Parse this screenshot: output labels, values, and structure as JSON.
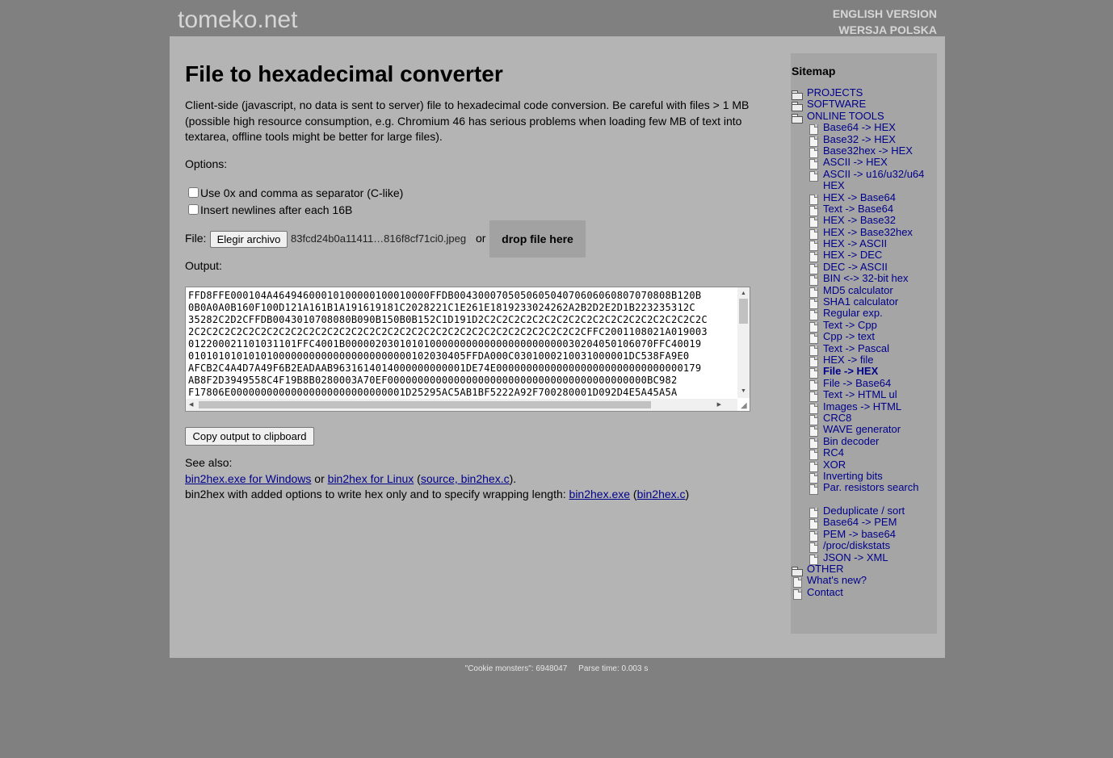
{
  "header": {
    "logo": "tomeko.net",
    "lang_english": "ENGLISH VERSION",
    "lang_polish": "WERSJA POLSKA"
  },
  "main": {
    "title": "File to hexadecimal converter",
    "description": "Client-side (javascript, no data is sent to server) file to hexadecimal code conversion. Be careful with files > 1 MB (possible high resource consumption, e.g. Chromium 46 has serious problems when loading few MB of text into textarea, offline tools might be better for large files).",
    "options_label": "Options:",
    "option_c_like": "Use 0x and comma as separator (C-like)",
    "option_newlines": "Insert newlines after each 16B",
    "option_c_like_checked": false,
    "option_newlines_checked": false,
    "file_label": "File:",
    "file_button": "Elegir archivo",
    "file_name": "83fcd24b0a11411…816f8cf71ci0.jpeg",
    "or_label": "or",
    "drop_label": "drop file here",
    "output_label": "Output:",
    "output_text": "FFD8FFE000104A46494600010100000100010000FFDB004300070505060504070606060807070808B120B\n0B0A0A0B160F100D121A161B1A191619181C2028221C1E261E1819233024262A2B2D2E2D1B223235312C\n35282C2D2CFFDB0043010708080B090B150B0B152C1D191D2C2C2C2C2C2C2C2C2C2C2C2C2C2C2C2C2C2C2C\n2C2C2C2C2C2C2C2C2C2C2C2C2C2C2C2C2C2C2C2C2C2C2C2C2C2C2C2C2C2C2C2C2CFFC2001108021A019003\n012200021101031101FFC4001B000002030101010000000000000000000000030204050106070FFC40019\n0101010101010100000000000000000000000102030405FFDA000C0301000210031000001DC538FA9E0\nAFCB2C4A4D7A49F6B2EADAAB9631614014000000000001DE74E0000000000000000000000000000000179\nAB8F2D3949558C4F19B8B0280003A70EF0000000000000000000000000000000000000000000BC982\nF17806E00000000000000000000000000001D25295AC5AB1BF5222A92F700280001D092D4E5A45A5A",
    "copy_button": "Copy output to clipboard",
    "see_also": "See also:",
    "link_windows": "bin2hex.exe for Windows",
    "or_text": " or ",
    "link_linux": "bin2hex for Linux",
    "paren_open": " (",
    "link_source": "source, bin2hex.c",
    "paren_close": ").",
    "bin2hex_text": "bin2hex with added options to write hex only and to specify wrapping length: ",
    "link_exe": "bin2hex.exe",
    "paren_open2": " (",
    "link_c": "bin2hex.c",
    "paren_close2": ")"
  },
  "sitemap": {
    "title": "Sitemap",
    "items": [
      {
        "label": "PROJECTS",
        "icon": "folder-icon"
      },
      {
        "label": "SOFTWARE",
        "icon": "folder-icon"
      },
      {
        "label": "ONLINE TOOLS",
        "icon": "folder-open-icon"
      },
      {
        "label": "Base64 -> HEX",
        "icon": "document-icon"
      },
      {
        "label": "Base32 -> HEX",
        "icon": "document-icon"
      },
      {
        "label": "Base32hex -> HEX",
        "icon": "document-icon"
      },
      {
        "label": "ASCII -> HEX",
        "icon": "document-icon"
      },
      {
        "label": "ASCII -> u16/u32/u64 HEX",
        "icon": "document-icon"
      },
      {
        "label": "HEX -> Base64",
        "icon": "document-icon"
      },
      {
        "label": "Text -> Base64",
        "icon": "document-icon"
      },
      {
        "label": "HEX -> Base32",
        "icon": "document-icon"
      },
      {
        "label": "HEX -> Base32hex",
        "icon": "document-icon"
      },
      {
        "label": "HEX -> ASCII",
        "icon": "document-icon"
      },
      {
        "label": "HEX -> DEC",
        "icon": "document-icon"
      },
      {
        "label": "DEC -> ASCII",
        "icon": "document-icon"
      },
      {
        "label": "BIN <-> 32-bit hex",
        "icon": "document-icon"
      },
      {
        "label": "MD5 calculator",
        "icon": "document-icon"
      },
      {
        "label": "SHA1 calculator",
        "icon": "document-icon"
      },
      {
        "label": "Regular exp.",
        "icon": "document-icon"
      },
      {
        "label": "Text -> Cpp",
        "icon": "document-icon"
      },
      {
        "label": "Cpp -> text",
        "icon": "document-icon"
      },
      {
        "label": "Text -> Pascal",
        "icon": "document-icon"
      },
      {
        "label": "HEX -> file",
        "icon": "document-icon"
      },
      {
        "label": "File -> HEX",
        "icon": "document-icon",
        "active": true
      },
      {
        "label": "File -> Base64",
        "icon": "document-icon"
      },
      {
        "label": "Text -> HTML ul",
        "icon": "document-icon"
      },
      {
        "label": "Images -> HTML",
        "icon": "document-icon"
      },
      {
        "label": "CRC8",
        "icon": "document-icon"
      },
      {
        "label": "WAVE generator",
        "icon": "document-icon"
      },
      {
        "label": "Bin decoder",
        "icon": "document-icon"
      },
      {
        "label": "RC4",
        "icon": "document-icon"
      },
      {
        "label": "XOR",
        "icon": "document-icon"
      },
      {
        "label": "Inverting bits",
        "icon": "document-icon"
      },
      {
        "label": "Par. resistors search",
        "icon": "document-icon"
      },
      {
        "label": "Deduplicate / sort",
        "icon": "document-icon"
      },
      {
        "label": "Base64 -> PEM",
        "icon": "document-icon"
      },
      {
        "label": "PEM -> base64",
        "icon": "document-icon"
      },
      {
        "label": "/proc/diskstats",
        "icon": "document-icon"
      },
      {
        "label": "JSON -> XML",
        "icon": "document-icon"
      },
      {
        "label": "OTHER",
        "icon": "folder-icon"
      },
      {
        "label": "What's new?",
        "icon": "document-icon"
      },
      {
        "label": "Contact",
        "icon": "document-icon"
      }
    ]
  },
  "footer": {
    "text": "\"Cookie monsters\": 6948047     Parse time: 0.003 s"
  }
}
